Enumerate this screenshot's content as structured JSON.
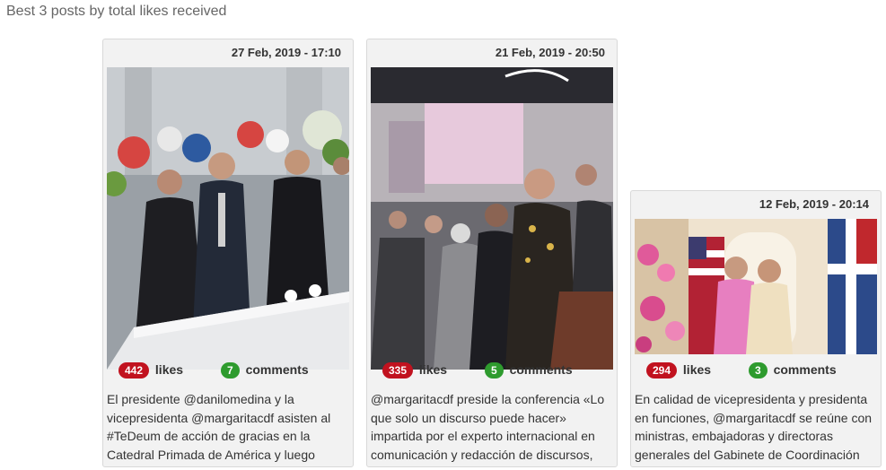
{
  "heading": "Best 3 posts by total likes received",
  "posts": [
    {
      "date": "27 Feb, 2019 - 17:10",
      "likes": "442",
      "likes_label": "likes",
      "comments": "7",
      "comments_label": "comments",
      "caption": "El presidente @danilomedina y la vicepresidenta @margaritacdf asisten al #TeDeum de acción de gracias en la Catedral Primada de América y luego"
    },
    {
      "date": "21 Feb, 2019 - 20:50",
      "likes": "335",
      "likes_label": "likes",
      "comments": "5",
      "comments_label": "comments",
      "caption": "@margaritacdf preside la conferencia «Lo que solo un discurso puede hacer» impartida por el experto internacional en comunicación y redacción de discursos,"
    },
    {
      "date": "12 Feb, 2019 - 20:14",
      "likes": "294",
      "likes_label": "likes",
      "comments": "3",
      "comments_label": "comments",
      "caption": "En calidad de vicepresidenta y presidenta en funciones, @margaritacdf se reúne con ministras, embajadoras y directoras generales del Gabinete de Coordinación"
    }
  ],
  "colors": {
    "likes_badge": "#c1121f",
    "comments_badge": "#2e9b2e"
  }
}
